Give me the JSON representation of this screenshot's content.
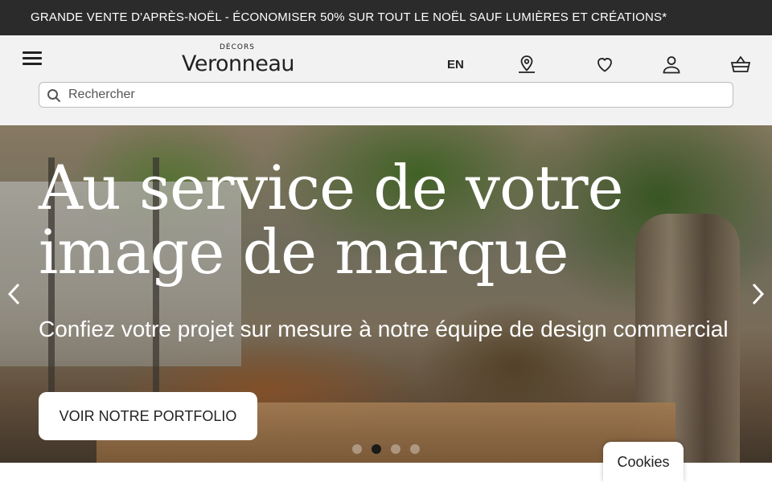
{
  "promo_banner": {
    "text": "GRANDE VENTE D'APRÈS-NOËL - ÉCONOMISER 50% SUR TOUT LE NOËL SAUF LUMIÈRES ET CRÉATIONS*"
  },
  "header": {
    "logo_small": "DÉCORS",
    "logo_big": "Veronneau",
    "lang_label": "EN",
    "icons": [
      "menu-icon",
      "location-pin-icon",
      "heart-icon",
      "user-icon",
      "basket-icon"
    ]
  },
  "search": {
    "placeholder": "Rechercher",
    "value": ""
  },
  "hero": {
    "title_line1": "Au service de votre",
    "title_line2": "image de marque",
    "subtitle": "Confiez votre projet sur mesure à notre équipe de design commercial",
    "cta_label": "VOIR NOTRE PORTFOLIO",
    "slide_count": 4,
    "active_slide": 2
  },
  "cookies": {
    "label": "Cookies"
  },
  "colors": {
    "promo_bg": "#2b2b2b",
    "header_bg": "#f2f2f2",
    "text_dark": "#222222",
    "active_dot": "#1a1a1a"
  }
}
